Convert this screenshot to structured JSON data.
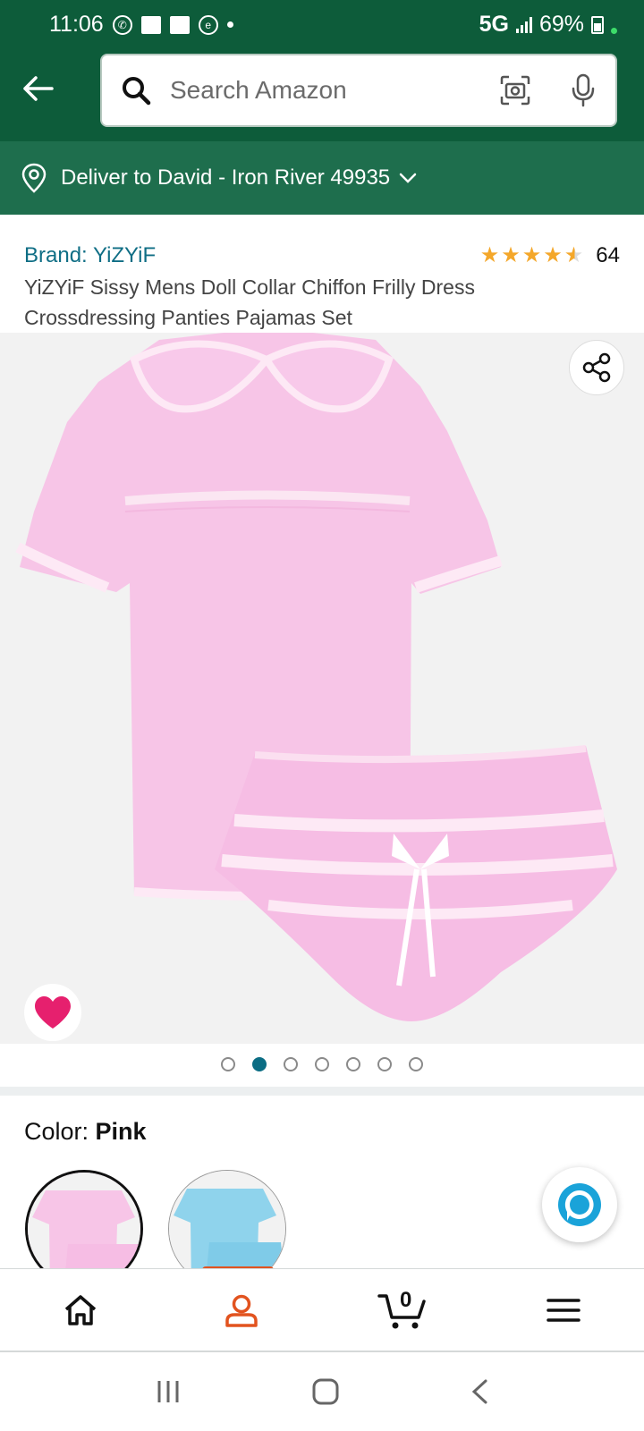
{
  "status_bar": {
    "time": "11:06",
    "network": "5G",
    "battery": "69%"
  },
  "search": {
    "placeholder": "Search Amazon"
  },
  "delivery": {
    "text": "Deliver to David - Iron River 49935"
  },
  "product": {
    "brand": "Brand: YiZYiF",
    "rating": 4.5,
    "rating_count": "64",
    "title": "YiZYiF Sissy Mens Doll Collar Chiffon Frilly Dress Crossdressing Panties Pajamas Set"
  },
  "gallery": {
    "image_count": 7,
    "active_index": 1
  },
  "color": {
    "label": "Color: ",
    "value": "Pink"
  },
  "bottom_nav": {
    "cart_count": "0"
  },
  "colors": {
    "header_bg": "#0d5c3a",
    "deliver_bg": "#1e6e4d",
    "link": "#0f6e85",
    "star": "#f4a72a",
    "accent": "#e2531f"
  }
}
